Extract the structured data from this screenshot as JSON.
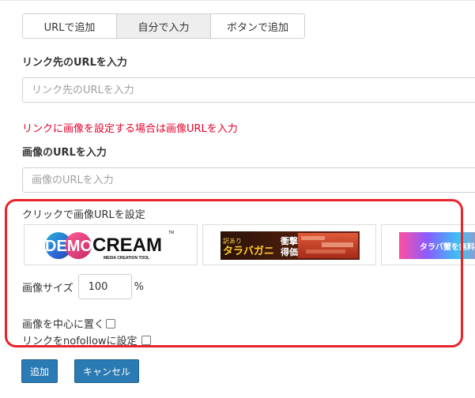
{
  "tabs": [
    {
      "label": "URLで追加",
      "active": false
    },
    {
      "label": "自分で入力",
      "active": true
    },
    {
      "label": "ボタンで追加",
      "active": false
    }
  ],
  "link_section": {
    "heading": "リンク先のURLを入力",
    "placeholder": "リンク先のURLを入力"
  },
  "warning_text": "リンクに画像を設定する場合は画像URLを入力",
  "image_section": {
    "heading": "画像のURLを入力",
    "placeholder": "画像のURLを入力"
  },
  "click_label": "クリックで画像URLを設定",
  "banners": {
    "demo": {
      "demo": "DEMO",
      "cream": "CREAM",
      "tm": "TM",
      "tagline": "MEDIA CREATION TOOL"
    },
    "crab": {
      "left": "訳あり",
      "main": "タラバガニ",
      "stamp1": "衝撃",
      "stamp2": "得価"
    },
    "crab2": {
      "text": "タラバ蟹を無料"
    }
  },
  "image_size": {
    "label": "画像サイズ",
    "value": "100",
    "unit": "%"
  },
  "checkboxes": [
    {
      "label": "画像を中心に置く",
      "checked": false
    },
    {
      "label": "リンクをnofollowに設定",
      "checked": false
    }
  ],
  "buttons": {
    "add": "追加",
    "cancel": "キャンセル"
  },
  "colors": {
    "warning": "#e4002b",
    "highlight_border": "#e8232b",
    "button_blue": "#2a7ab3",
    "active_tab": "#eeeeee"
  }
}
